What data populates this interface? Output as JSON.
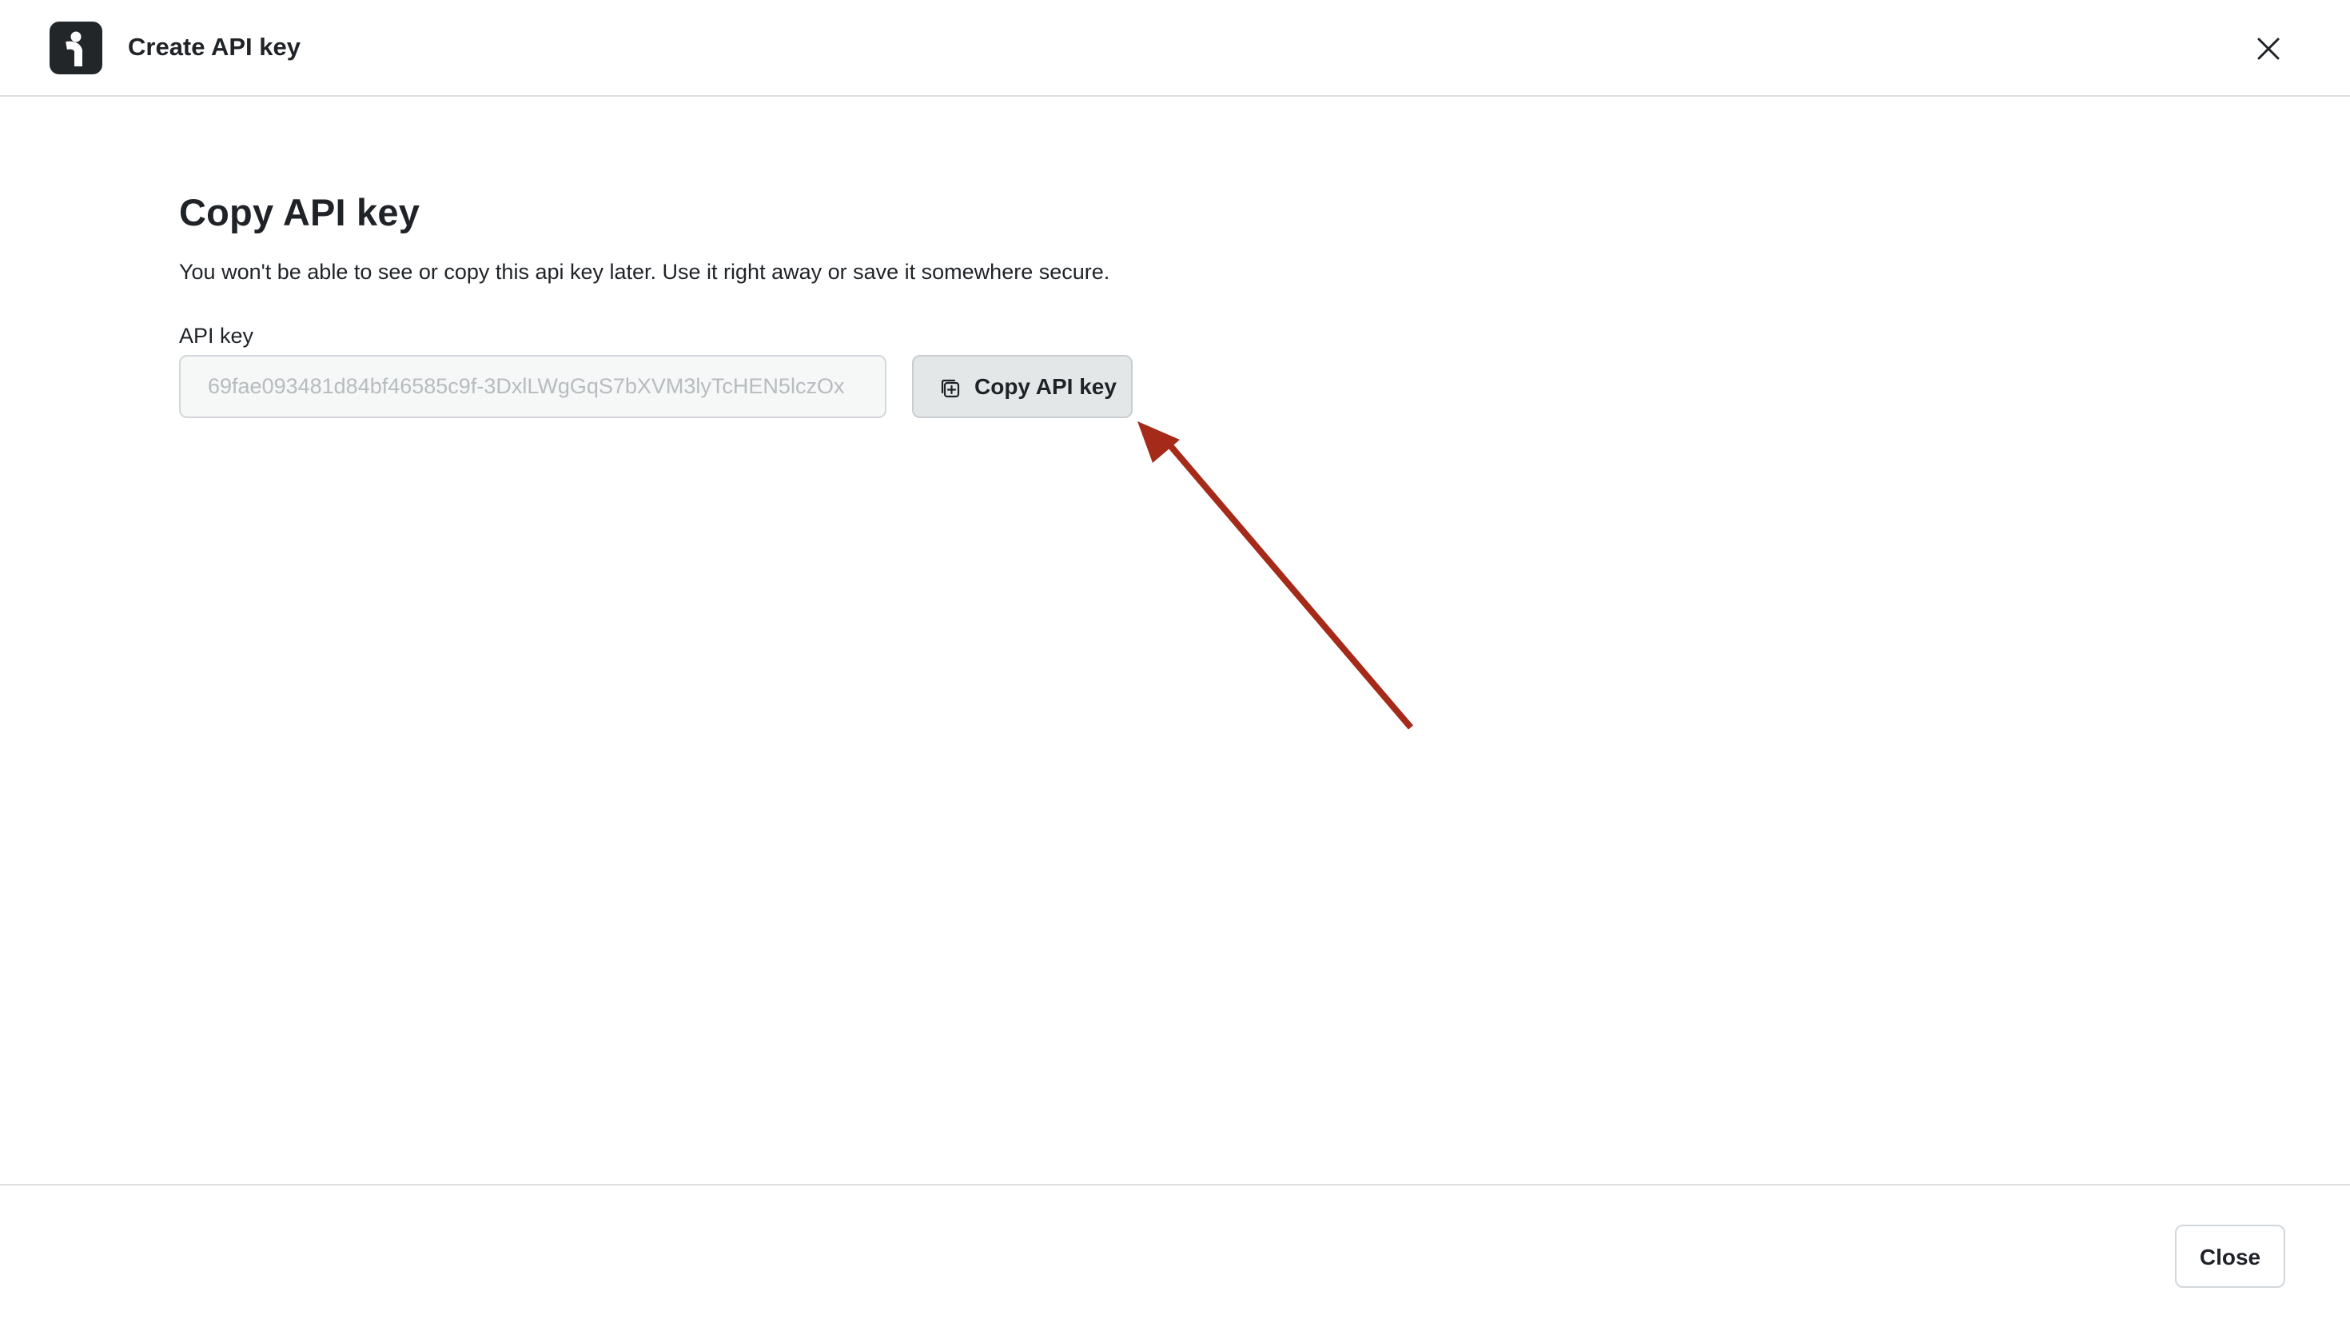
{
  "header": {
    "title": "Create API key",
    "logo_icon": "brand-logo-icon",
    "close_icon": "close-icon"
  },
  "main": {
    "title": "Copy API key",
    "description": "You won't be able to see or copy this api key later. Use it right away or save it somewhere secure.",
    "api_key_label": "API key",
    "api_key_value": "69fae093481d84bf46585c9f-3DxlLWgGqS7bXVM3lyTcHEN5lczOx",
    "copy_button_label": "Copy API key",
    "copy_icon": "copy-icon"
  },
  "footer": {
    "close_label": "Close"
  },
  "colors": {
    "annotation_arrow": "#a52a1a",
    "text": "#1f2328",
    "divider": "#dcdfe2"
  }
}
